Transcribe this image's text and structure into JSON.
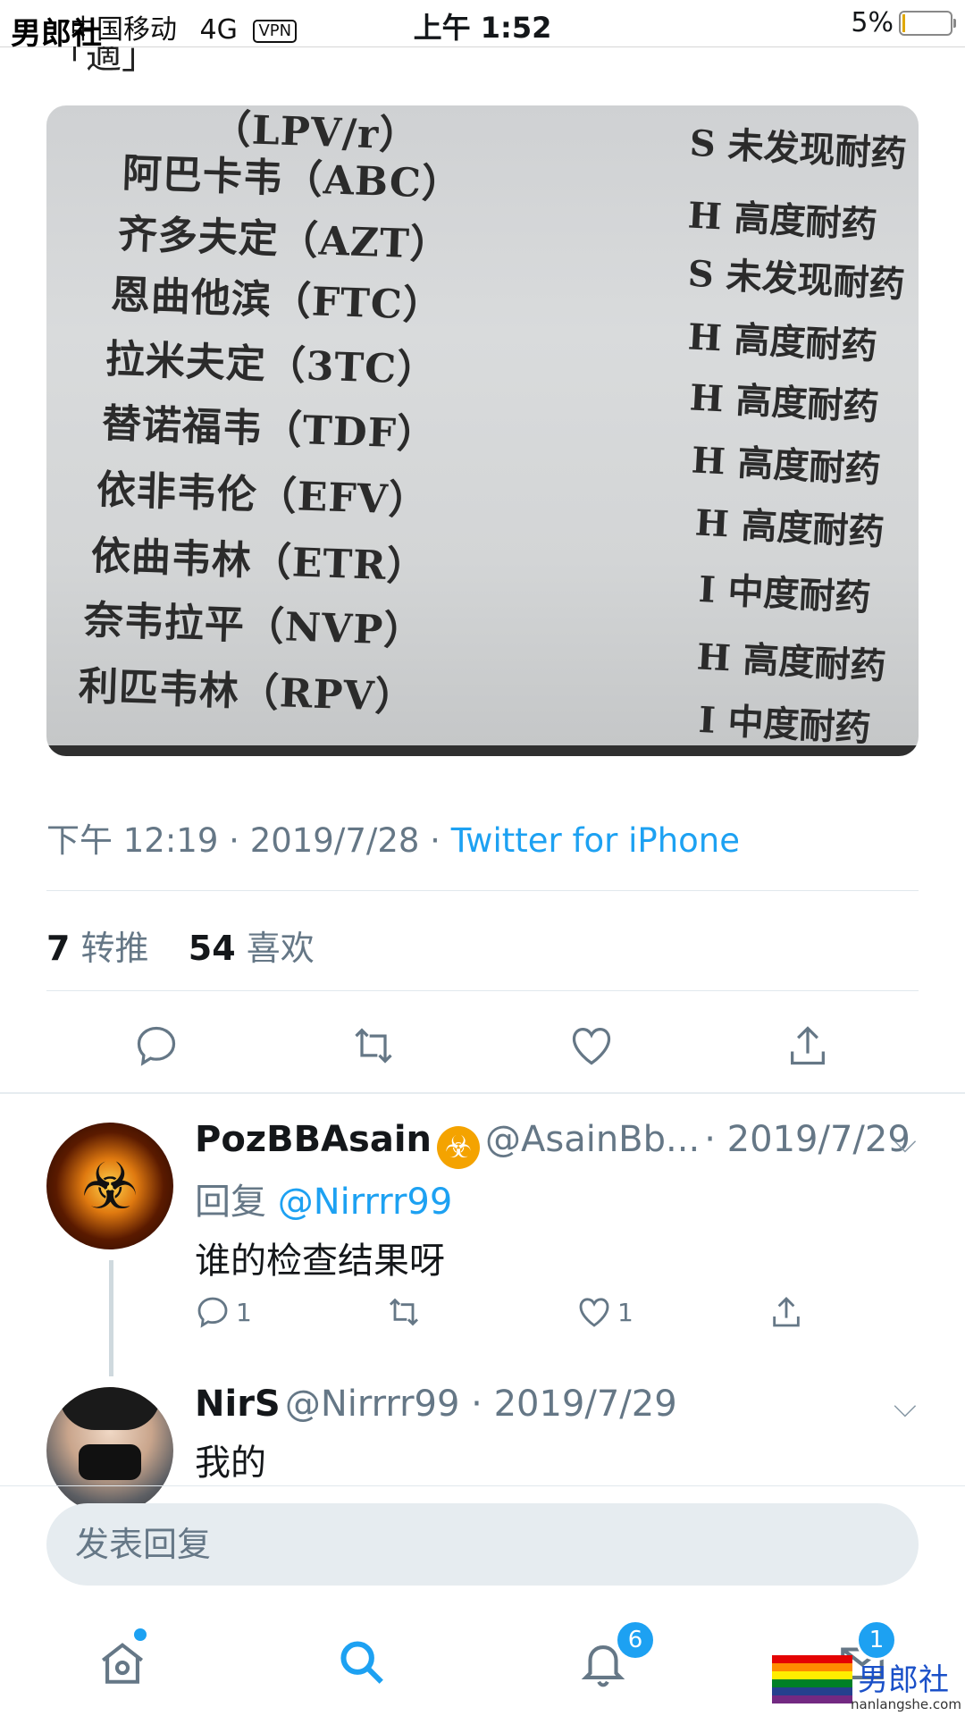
{
  "status_bar": {
    "carrier": "中国移动",
    "network": "4G",
    "vpn": "VPN",
    "watermark": "男郎社",
    "time": "上午 1:52",
    "battery": "5%"
  },
  "cut_text": "「適」",
  "photo": {
    "rows": [
      {
        "drug": "（LPV/r）",
        "result": "S 未发现耐药"
      },
      {
        "drug": "阿巴卡韦（ABC）",
        "result": ""
      },
      {
        "drug": "齐多夫定（AZT）",
        "result": "H 高度耐药"
      },
      {
        "drug": "恩曲他滨（FTC）",
        "result": "S 未发现耐药"
      },
      {
        "drug": "拉米夫定（3TC）",
        "result": "H 高度耐药"
      },
      {
        "drug": "替诺福韦（TDF）",
        "result": "H 高度耐药"
      },
      {
        "drug": "依非韦伦（EFV）",
        "result": "H 高度耐药"
      },
      {
        "drug": "依曲韦林（ETR）",
        "result": "H 高度耐药"
      },
      {
        "drug": "奈韦拉平（NVP）",
        "result": "I 中度耐药"
      },
      {
        "drug": "利匹韦林（RPV）",
        "result": "H 高度耐药"
      },
      {
        "drug": "",
        "result": "I 中度耐药"
      }
    ]
  },
  "tweet": {
    "time": "下午 12:19",
    "sep1": "·",
    "date": "2019/7/28",
    "sep2": "·",
    "source": "Twitter for iPhone",
    "retweet_count": "7",
    "retweet_label": "转推",
    "like_count": "54",
    "like_label": "喜欢"
  },
  "replies": [
    {
      "name": "PozBBAsain",
      "badge": "☣",
      "handle": "@AsainBb...",
      "date": "· 2019/7/29",
      "reply_prefix": "回复",
      "reply_to": "@Nirrrr99",
      "text": "谁的检查结果呀",
      "reply_count": "1",
      "like_count": "1"
    },
    {
      "name": "NirS",
      "handle": "@Nirrrr99 · 2019/7/29",
      "text": "我的"
    }
  ],
  "composer": {
    "placeholder": "发表回复"
  },
  "tab_bar": {
    "notifications_badge": "6",
    "messages_badge": "1"
  },
  "logo": {
    "text": "男郎社",
    "url": "nanlangshe.com",
    "colors": [
      "#e40303",
      "#ff8c00",
      "#ffed00",
      "#008026",
      "#24408e",
      "#732982"
    ]
  },
  "colors": {
    "accent": "#1da1f2",
    "secondary_text": "#657786"
  }
}
